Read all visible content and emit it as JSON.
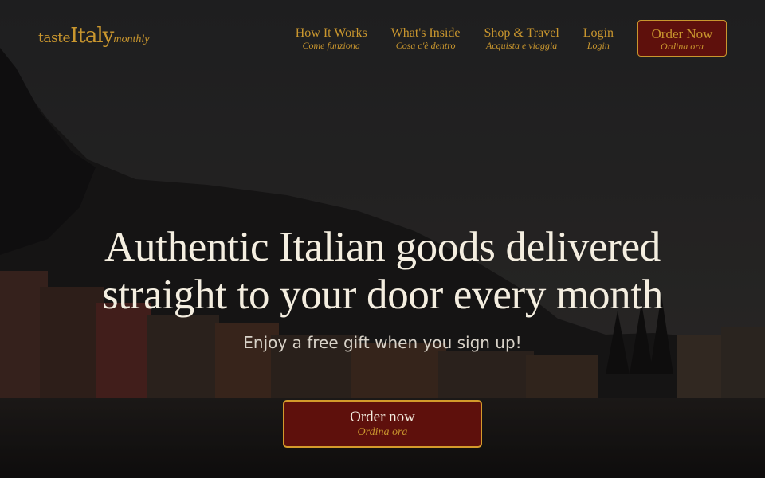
{
  "brand": {
    "word1": "taste",
    "word2": "Italy",
    "word3": "monthly"
  },
  "nav": {
    "items": [
      {
        "label": "How It Works",
        "sub": "Come funziona"
      },
      {
        "label": "What's Inside",
        "sub": "Cosa c'è dentro"
      },
      {
        "label": "Shop & Travel",
        "sub": "Acquista e viaggia"
      },
      {
        "label": "Login",
        "sub": "Login"
      }
    ],
    "order": {
      "label": "Order Now",
      "sub": "Ordina ora"
    }
  },
  "hero": {
    "headline_line1": "Authentic Italian goods delivered",
    "headline_line2": "straight to your door every month",
    "subtext": "Enjoy a free gift when you sign up!",
    "cta": {
      "label": "Order now",
      "sub": "Ordina ora"
    }
  },
  "colors": {
    "accent": "#c9962e",
    "button_bg": "#5e100c",
    "headline": "#f4eee0"
  },
  "icons": [
    "hero-background-image"
  ]
}
